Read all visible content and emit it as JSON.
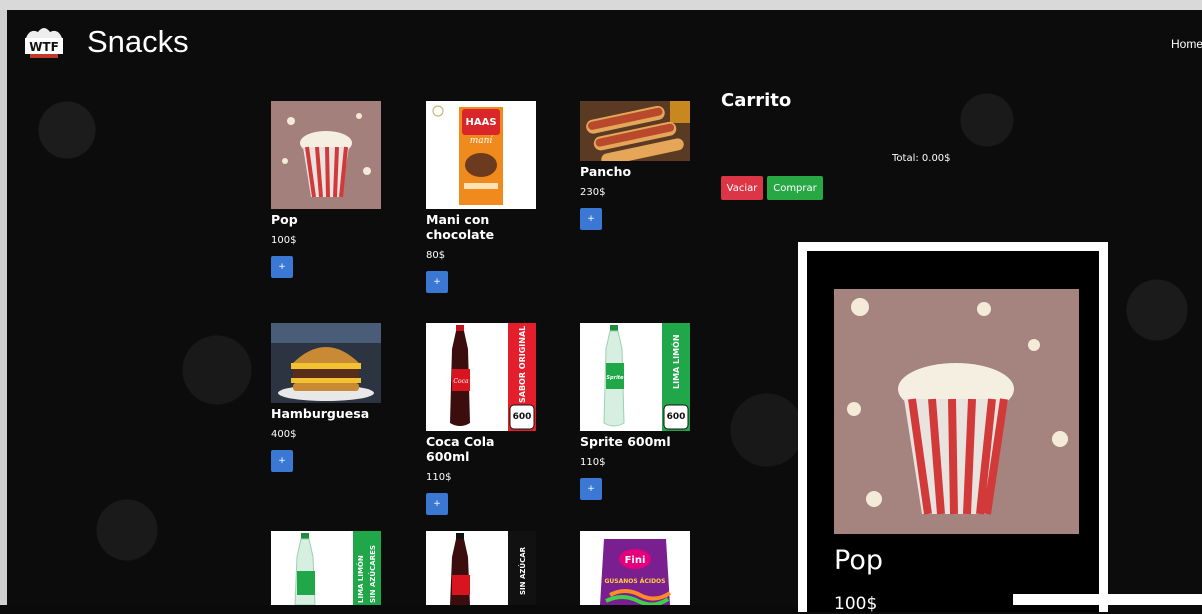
{
  "header": {
    "brand_title": "Snacks",
    "nav_home": "Home",
    "logo_icon": "wtf-logo-icon"
  },
  "products": [
    {
      "name": "Pop",
      "price": "100$",
      "add_label": "+",
      "image": "popcorn-image"
    },
    {
      "name": "Mani con chocolate",
      "price": "80$",
      "add_label": "+",
      "image": "mani-chocolate-image"
    },
    {
      "name": "Pancho",
      "price": "230$",
      "add_label": "+",
      "image": "hotdog-image"
    },
    {
      "name": "Hamburguesa",
      "price": "400$",
      "add_label": "+",
      "image": "burger-image"
    },
    {
      "name": "Coca Cola 600ml",
      "price": "110$",
      "add_label": "+",
      "image": "coca-cola-bottle-image",
      "bottle_text": "SABOR ORIGINAL",
      "size_text": "600"
    },
    {
      "name": "Sprite 600ml",
      "price": "110$",
      "add_label": "+",
      "image": "sprite-bottle-image",
      "bottle_text": "LIMA LIMÓN",
      "size_text": "600"
    },
    {
      "name": "",
      "price": "",
      "image": "sprite-zero-bottle-image",
      "bottle_text": "LIMA LIMÓN",
      "bottle_text2": "SIN AZÚCARES"
    },
    {
      "name": "",
      "price": "",
      "image": "coca-cola-zero-bottle-image",
      "bottle_text": "SIN AZÚCAR"
    },
    {
      "name": "",
      "price": "",
      "image": "fini-gummies-image",
      "brand_text": "Fini",
      "pack_text": "GUSANOS ÁCIDOS"
    }
  ],
  "cart": {
    "title": "Carrito",
    "total": "Total: 0.00$",
    "empty_label": "Vaciar",
    "buy_label": "Comprar"
  },
  "preview": {
    "name": "Pop",
    "price": "100$"
  },
  "colors": {
    "add_button": "#3a78d4",
    "empty_button": "#dc3545",
    "buy_button": "#28a745",
    "background": "#0c0c0c"
  }
}
